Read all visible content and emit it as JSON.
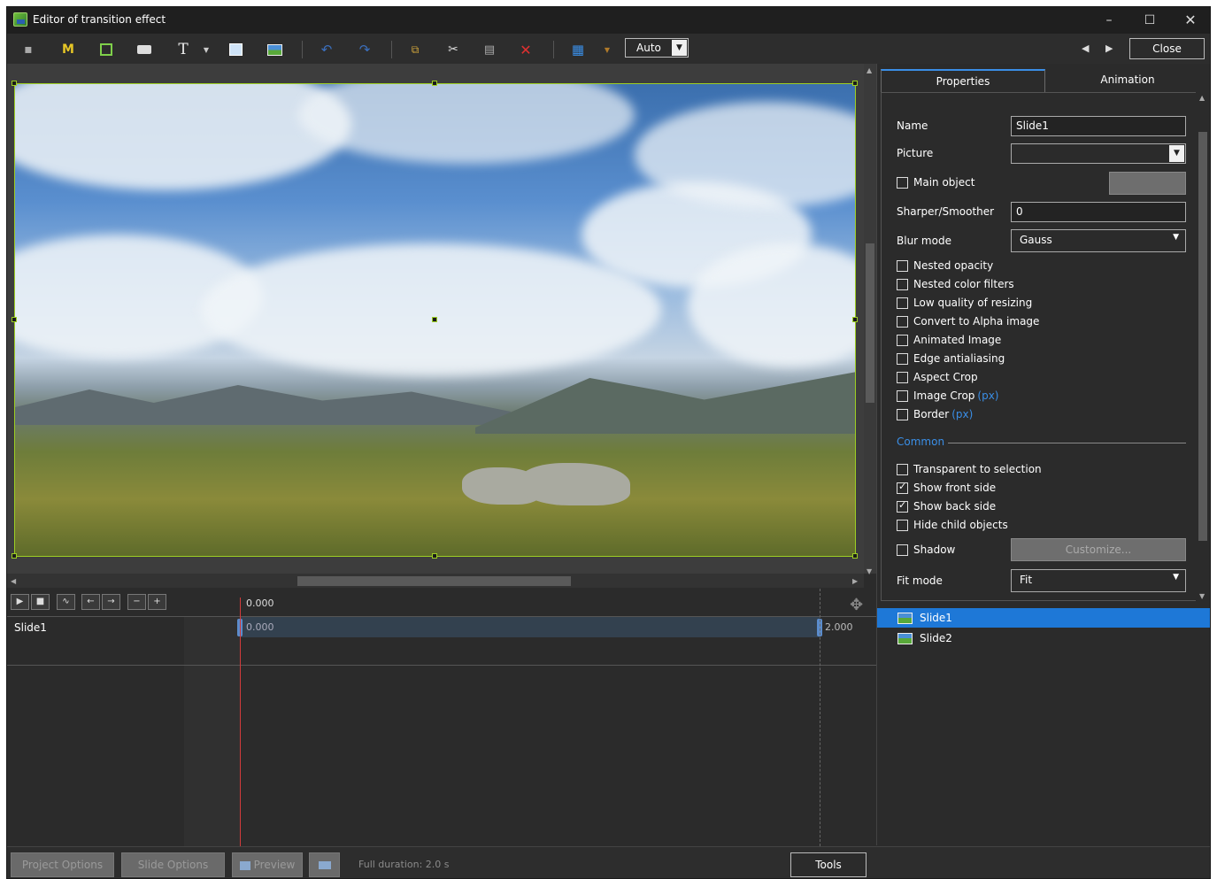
{
  "window": {
    "title": "Editor of transition effect"
  },
  "toolbar": {
    "auto_select_value": "Auto",
    "close_label": "Close"
  },
  "timeline": {
    "ruler_time": "0.000",
    "track_label": "Slide1",
    "start_time": "0.000",
    "end_time": "2.000"
  },
  "tabs": {
    "properties": "Properties",
    "animation": "Animation"
  },
  "properties": {
    "name_label": "Name",
    "name_value": "Slide1",
    "picture_label": "Picture",
    "picture_value": "",
    "main_object_label": "Main object",
    "sharper_label": "Sharper/Smoother",
    "sharper_value": "0",
    "blur_mode_label": "Blur mode",
    "blur_mode_value": "Gauss",
    "checkboxes": [
      {
        "label": "Nested opacity",
        "checked": false
      },
      {
        "label": "Nested color filters",
        "checked": false
      },
      {
        "label": "Low quality of resizing",
        "checked": false
      },
      {
        "label": "Convert to Alpha image",
        "checked": false
      },
      {
        "label": "Animated Image",
        "checked": false
      },
      {
        "label": "Edge antialiasing",
        "checked": false
      },
      {
        "label": "Aspect Crop",
        "checked": false
      },
      {
        "label": "Image Crop",
        "suffix": "(px)",
        "checked": false
      },
      {
        "label": "Border",
        "suffix": "(px)",
        "checked": false
      }
    ],
    "common_label": "Common",
    "common_checkboxes": [
      {
        "label": "Transparent to selection",
        "checked": false
      },
      {
        "label": "Show front side",
        "checked": true
      },
      {
        "label": "Show back side",
        "checked": true
      },
      {
        "label": "Hide child objects",
        "checked": false
      }
    ],
    "shadow_label": "Shadow",
    "customize_label": "Customize...",
    "fit_mode_label": "Fit mode",
    "fit_mode_value": "Fit"
  },
  "objects": [
    {
      "name": "Slide1",
      "selected": true
    },
    {
      "name": "Slide2",
      "selected": false
    }
  ],
  "bottom": {
    "project_options": "Project Options",
    "slide_options": "Slide Options",
    "preview": "Preview",
    "status": "Full duration: 2.0 s",
    "tools": "Tools"
  },
  "colors": {
    "accent": "#3a8ee6",
    "selection": "#1e78d7",
    "frame": "#9dcf23"
  }
}
